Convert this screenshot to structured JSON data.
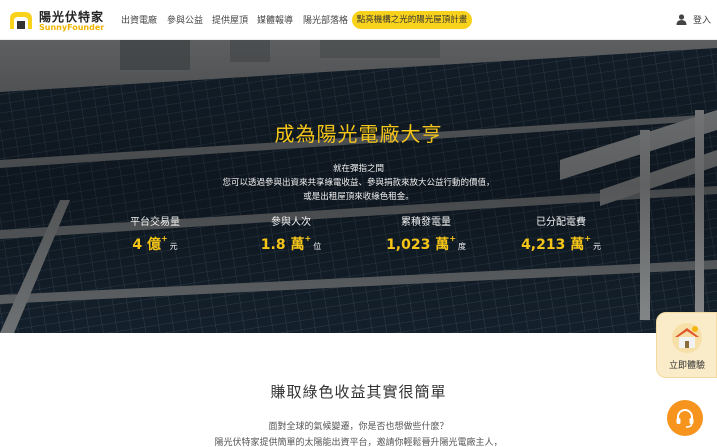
{
  "brand": {
    "name": "陽光伏特家",
    "subtitle": "SunnyFounder",
    "accent": "#f9d21c",
    "title_color": "#f5c518"
  },
  "nav": {
    "items": [
      {
        "label": "出資電廠"
      },
      {
        "label": "參與公益"
      },
      {
        "label": "提供屋頂"
      },
      {
        "label": "媒體報導"
      },
      {
        "label": "陽光部落格"
      }
    ],
    "cta_label": "點亮機構之光的陽光屋頂計畫",
    "login_label": "登入",
    "login_icon": "user-icon"
  },
  "hero": {
    "title": "成為陽光電廠大亨",
    "desc_lines": [
      "就在彈指之間",
      "您可以透過參與出資來共享綠電收益、參與捐款來放大公益行動的價值，",
      "或是出租屋頂來收綠色租金。"
    ],
    "stats": [
      {
        "label": "平台交易量",
        "value": "4 億",
        "plus": "+",
        "unit": "元"
      },
      {
        "label": "參與人次",
        "value": "1.8 萬",
        "plus": "+",
        "unit": "位"
      },
      {
        "label": "累積發電量",
        "value": "1,023 萬",
        "plus": "+",
        "unit": "度"
      },
      {
        "label": "已分配電費",
        "value": "4,213 萬",
        "plus": "+",
        "unit": "元"
      }
    ]
  },
  "widgets": {
    "try_now_label": "立即體驗",
    "try_now_icon": "solar-house-icon",
    "support_icon": "headset-icon"
  },
  "intro": {
    "title": "賺取綠色收益其實很簡單",
    "lines": [
      "面對全球的氣候變遷，你是否也想做些什麼？",
      "陽光伏特家提供簡單的太陽能出資平台，邀請你輕鬆晉升陽光電廠主人，"
    ]
  }
}
